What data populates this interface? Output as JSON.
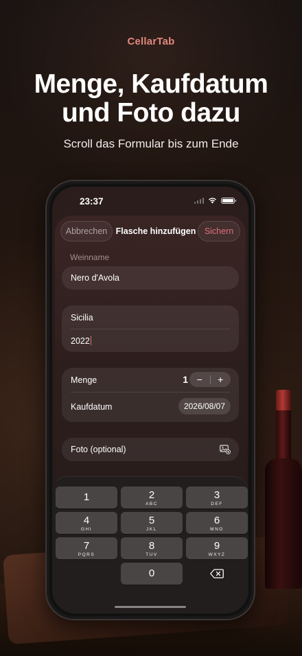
{
  "marketing": {
    "brand": "CellarTab",
    "headline_line1": "Menge, Kaufdatum",
    "headline_line2": "und Foto dazu",
    "subline": "Scroll das Formular bis zum Ende"
  },
  "status_bar": {
    "time": "23:37"
  },
  "nav": {
    "cancel_label": "Abbrechen",
    "title": "Flasche hinzufügen",
    "save_label": "Sichern"
  },
  "form": {
    "wine_name_label": "Weinname",
    "wine_name_value": "Nero d'Avola",
    "region_value": "Sicilia",
    "vintage_value": "2022",
    "quantity_label": "Menge",
    "quantity_value": "1",
    "stepper_minus": "−",
    "stepper_plus": "+",
    "purchase_date_label": "Kaufdatum",
    "purchase_date_value": "2026/08/07",
    "photo_label": "Foto (optional)"
  },
  "keyboard": {
    "keys": [
      {
        "num": "1",
        "letters": ""
      },
      {
        "num": "2",
        "letters": "ABC"
      },
      {
        "num": "3",
        "letters": "DEF"
      },
      {
        "num": "4",
        "letters": "GHI"
      },
      {
        "num": "5",
        "letters": "JKL"
      },
      {
        "num": "6",
        "letters": "MNO"
      },
      {
        "num": "7",
        "letters": "PQRS"
      },
      {
        "num": "8",
        "letters": "TUV"
      },
      {
        "num": "9",
        "letters": "WXYZ"
      },
      {
        "num": "0",
        "letters": ""
      }
    ]
  },
  "colors": {
    "accent": "#e0707c",
    "brand": "#e2887d"
  }
}
